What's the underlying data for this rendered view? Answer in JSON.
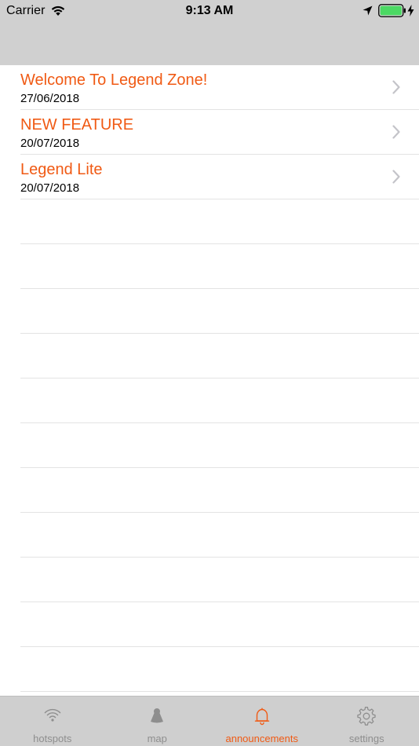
{
  "status_bar": {
    "carrier": "Carrier",
    "time": "9:13 AM",
    "icons": [
      "wifi-icon",
      "location-arrow-icon",
      "battery-icon",
      "charging-bolt-icon"
    ]
  },
  "announcements": [
    {
      "title": "Welcome To Legend Zone!",
      "date": "27/06/2018"
    },
    {
      "title": "NEW FEATURE",
      "date": "20/07/2018"
    },
    {
      "title": "Legend Lite",
      "date": "20/07/2018"
    }
  ],
  "tab_bar": {
    "tabs": [
      {
        "label": "hotspots",
        "icon": "wifi-icon",
        "active": false
      },
      {
        "label": "map",
        "icon": "map-pin-icon",
        "active": false
      },
      {
        "label": "announcements",
        "icon": "bell-icon",
        "active": true
      },
      {
        "label": "settings",
        "icon": "gear-icon",
        "active": false
      }
    ]
  },
  "colors": {
    "accent": "#f05a14",
    "header_background": "#d0d0d0",
    "tab_bar_background": "#cfcfcf",
    "inactive_tab": "#8e8e8e",
    "battery_fill": "#4cd964"
  }
}
